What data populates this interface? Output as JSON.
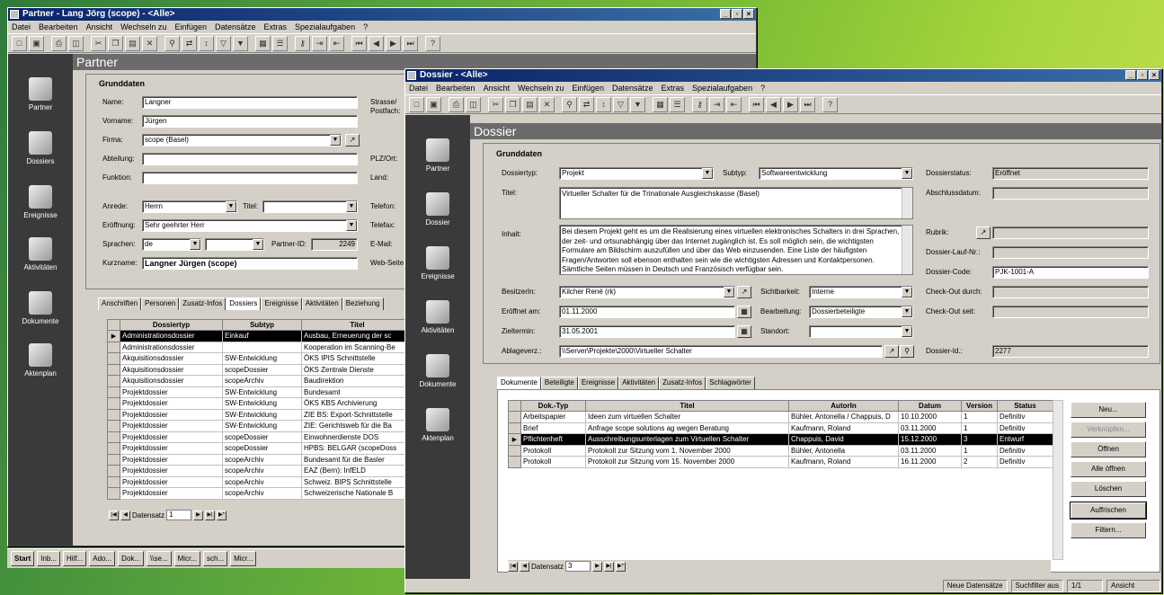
{
  "partner": {
    "title": "Partner - Lang Jörg (scope) - <Alle>",
    "menu": [
      "Datei",
      "Bearbeiten",
      "Ansicht",
      "Wechseln zu",
      "Einfügen",
      "Datensätze",
      "Extras",
      "Spezialaufgaben",
      "?"
    ],
    "section": "Partner",
    "group": "Grunddaten",
    "labels": {
      "name": "Name:",
      "vorname": "Vorname:",
      "firma": "Firma:",
      "abteilung": "Abteilung:",
      "funktion": "Funktion:",
      "anrede": "Anrede:",
      "titel": "Titel:",
      "eroeffnung": "Eröffnung:",
      "sprachen": "Sprachen:",
      "partnerid": "Partner-ID:",
      "kurzname": "Kurzname:",
      "strasse": "Strasse/",
      "postfach": "Postfach:",
      "plz": "PLZ/Ort:",
      "land": "Land:",
      "telefon": "Telefon:",
      "telefax": "Telefax:",
      "email": "E-Mail:",
      "web": "Web-Seite"
    },
    "values": {
      "name": "Langner",
      "vorname": "Jürgen",
      "firma": "scope (Basel)",
      "anrede": "Herrn",
      "eroeffnung": "Sehr geehrter Herr",
      "sprachen": "de",
      "partnerid": "2249",
      "kurzname": "Langner Jürgen (scope)"
    },
    "tabs": [
      "Anschriften",
      "Personen",
      "Zusatz-Infos",
      "Dossiers",
      "Ereignisse",
      "Aktivitäten",
      "Beziehung"
    ],
    "active_tab": "Dossiers",
    "columns": [
      "Dossiertyp",
      "Subtyp",
      "Titel"
    ],
    "rows": [
      [
        "Administrationsdossier",
        "Einkauf",
        "Ausbau, Erneuerung der sc"
      ],
      [
        "Administrationsdossier",
        "",
        "Kooperation im Scanning-Be"
      ],
      [
        "Akquisitionsdossier",
        "SW-Entwicklung",
        "ÖKS IPIS Schnittstelle"
      ],
      [
        "Akquisitionsdossier",
        "scopeDossier",
        "ÖKS Zentrale Dienste"
      ],
      [
        "Akquisitionsdossier",
        "scopeArchiv",
        "Baudirektion"
      ],
      [
        "Projektdossier",
        "SW-Entwicklung",
        "Bundesamt"
      ],
      [
        "Projektdossier",
        "SW-Entwicklung",
        "ÖKS KBS Archivierung"
      ],
      [
        "Projektdossier",
        "SW-Entwicklung",
        "ZIE BS: Export-Schnittstelle"
      ],
      [
        "Projektdossier",
        "SW-Entwicklung",
        "ZIE: Gerichtsweb für die Ba"
      ],
      [
        "Projektdossier",
        "scopeDossier",
        "Einwohnerdienste DOS"
      ],
      [
        "Projektdossier",
        "scopeDossier",
        "HPBS: BELGAR (scopeDoss"
      ],
      [
        "Projektdossier",
        "scopeArchiv",
        "Bundesamt für die Basler"
      ],
      [
        "Projektdossier",
        "scopeArchiv",
        "EAZ (Bern): InfELD"
      ],
      [
        "Projektdossier",
        "scopeArchiv",
        "Schweiz. BIPS Schnittstelle"
      ],
      [
        "Projektdossier",
        "scopeArchiv",
        "Schweizerische Nationale B"
      ]
    ],
    "nav_label": "Datensatz",
    "nav_value": "1"
  },
  "sidebar_left": [
    "Partner",
    "Dossiers",
    "Ereignisse",
    "Aktivitäten",
    "Dokumente",
    "Aktenplan"
  ],
  "sidebar_right": [
    "Partner",
    "Dossier",
    "Ereignisse",
    "Aktivitäten",
    "Dokumente",
    "Aktenplan"
  ],
  "taskbar": [
    "Start",
    "Inb...",
    "Hilf...",
    "Ado...",
    "Dok...",
    "\\\\se...",
    "Micr...",
    "sch...",
    "Micr..."
  ],
  "dossier": {
    "title": "Dossier - <Alle>",
    "menu": [
      "Datei",
      "Bearbeiten",
      "Ansicht",
      "Wechseln zu",
      "Einfügen",
      "Datensätze",
      "Extras",
      "Spezialaufgaben",
      "?"
    ],
    "section": "Dossier",
    "group": "Grunddaten",
    "labels": {
      "dossiertyp": "Dossiertyp:",
      "subtyp": "Subtyp:",
      "dossierstatus": "Dossierstatus:",
      "titel": "Titel:",
      "abschluss": "Abschlussdatum:",
      "inhalt": "Inhalt:",
      "rubrik": "Rubrik:",
      "laufnr": "Dossier-Lauf-Nr.:",
      "code": "Dossier-Code:",
      "besitzer": "BesitzerIn:",
      "sichtbarkeit": "Sichtbarkeit:",
      "checkout": "Check-Out durch:",
      "eroeffnet": "Eröffnet am:",
      "bearbeitung": "Bearbeitung:",
      "checkoutseit": "Check-Out seit:",
      "zieltermin": "Zieltermin:",
      "standort": "Standort:",
      "ablage": "Ablageverz.:",
      "dossierid": "Dossier-Id.:"
    },
    "values": {
      "dossiertyp": "Projekt",
      "subtyp": "Softwareentwicklung",
      "dossierstatus": "Eröffnet",
      "titel": "Virtueller Schalter für die Trinationale Ausgleichskasse (Basel)",
      "inhalt": "Bei diesem Projekt geht es um die Realisierung eines virtuellen elektronisches Schalters in drei Sprachen, der zeit- und ortsunabhängig über das Internet zugänglich ist. Es soll möglich sein, die wichtigsten Formulare am Bildschirm auszufüllen und über das Web einzusenden. Eine Liste der häufigsten Fragen/Antworten soll ebenson enthalten sein wie die wichtigsten Adressen und Kontaktpersonen. Sämtliche Seiten müssen in Deutsch und Französisch verfügbar sein.",
      "code": "PJK-1001-A",
      "besitzer": "Kilcher René (rk)",
      "sichtbarkeit": "Interne",
      "eroeffnet": "01.11.2000",
      "bearbeitung": "Dossierbeteiligte",
      "zieltermin": "31.05.2001",
      "ablage": "\\\\Server\\Projekte\\2000\\Virtueller Schalter",
      "dossierid": "2277"
    },
    "tabs": [
      "Dokumente",
      "Beteiligte",
      "Ereignisse",
      "Aktivitäten",
      "Zusatz-Infos",
      "Schlagwörter"
    ],
    "active_tab": "Dokumente",
    "columns": [
      "Dok.-Typ",
      "Titel",
      "AutorIn",
      "Datum",
      "Version",
      "Status"
    ],
    "rows": [
      [
        "Arbeitspapier",
        "Ideen zum virtuellen Schalter",
        "Bühler, Antonella / Chappuis, D",
        "10.10.2000",
        "1",
        "Definitiv"
      ],
      [
        "Brief",
        "Anfrage scope solutions ag wegen Beratung",
        "Kaufmann, Roland",
        "03.11.2000",
        "1",
        "Definitiv"
      ],
      [
        "Pflichtenheft",
        "Ausschreibungsunterlagen zum Virtuellen Schalter",
        "Chappuis, David",
        "15.12.2000",
        "3",
        "Entwurf"
      ],
      [
        "Protokoll",
        "Protokoll zur Sitzung vom 1. November 2000",
        "Bühler, Antonella",
        "03.11.2000",
        "1",
        "Definitiv"
      ],
      [
        "Protokoll",
        "Protokoll zur Sitzung vom 15. November 2000",
        "Kaufmann, Roland",
        "16.11.2000",
        "2",
        "Definitiv"
      ]
    ],
    "selected_row": 2,
    "buttons": [
      "Neu...",
      "Verknüpfen...",
      "Öffnen",
      "Alle öffnen",
      "Löschen",
      "Auffrischen",
      "Filtern..."
    ],
    "nav_label": "Datensatz",
    "nav_value": "3",
    "status": [
      "Neue Datensätze",
      "Suchfilter aus",
      "1/1",
      "Ansicht"
    ]
  }
}
